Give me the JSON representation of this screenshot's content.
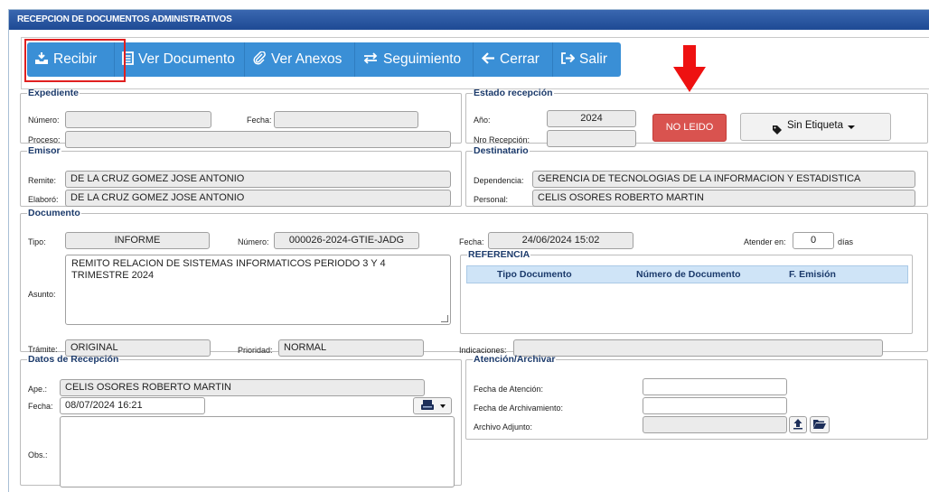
{
  "title": "RECEPCION DE DOCUMENTOS ADMINISTRATIVOS",
  "toolbar": {
    "recibir": "Recibir",
    "ver_documento": "Ver Documento",
    "ver_anexos": "Ver Anexos",
    "seguimiento": "Seguimiento",
    "cerrar": "Cerrar",
    "salir": "Salir"
  },
  "expediente": {
    "legend": "Expediente",
    "numero_label": "Número:",
    "numero": "",
    "fecha_label": "Fecha:",
    "fecha": "",
    "proceso_label": "Proceso:",
    "proceso": ""
  },
  "estado": {
    "legend": "Estado recepción",
    "anio_label": "Año:",
    "anio": "2024",
    "nro_label": "Nro Recepción:",
    "nro": "",
    "status": "NO LEIDO",
    "etiqueta": "Sin Etiqueta"
  },
  "emisor": {
    "legend": "Emisor",
    "remite_label": "Remite:",
    "remite": "DE LA CRUZ GOMEZ JOSE ANTONIO",
    "elaboro_label": "Elaboró:",
    "elaboro": "DE LA CRUZ GOMEZ JOSE ANTONIO"
  },
  "destinatario": {
    "legend": "Destinatario",
    "dependencia_label": "Dependencia:",
    "dependencia": "GERENCIA DE TECNOLOGIAS DE LA INFORMACION Y ESTADISTICA",
    "personal_label": "Personal:",
    "personal": "CELIS OSORES ROBERTO MARTIN"
  },
  "documento": {
    "legend": "Documento",
    "tipo_label": "Tipo:",
    "tipo": "INFORME",
    "numero_label": "Número:",
    "numero": "000026-2024-GTIE-JADG",
    "fecha_label": "Fecha:",
    "fecha": "24/06/2024 15:02",
    "atender_label": "Atender en:",
    "atender": "0",
    "dias_label": "días",
    "asunto_label": "Asunto:",
    "asunto": "REMITO RELACION DE SISTEMAS INFORMATICOS PERIODO 3 Y 4 TRIMESTRE 2024",
    "tramite_label": "Trámite:",
    "tramite": "ORIGINAL",
    "prioridad_label": "Prioridad:",
    "prioridad": "NORMAL",
    "indicaciones_label": "Indicaciones:",
    "indicaciones": ""
  },
  "referencia": {
    "legend": "REFERENCIA",
    "columns": [
      "Tipo Documento",
      "Número de Documento",
      "F. Emisión"
    ]
  },
  "recepcion": {
    "legend": "Datos de Recepción",
    "ape_label": "Ape.:",
    "ape": "CELIS OSORES ROBERTO MARTIN",
    "fecha_label": "Fecha:",
    "fecha": "08/07/2024 16:21",
    "obs_label": "Obs.:",
    "obs": ""
  },
  "atencion": {
    "legend": "Atención/Archivar",
    "fecha_atencion_label": "Fecha de Atención:",
    "fecha_atencion": "",
    "fecha_archivamiento_label": "Fecha de Archivamiento:",
    "fecha_archivamiento": "",
    "archivo_label": "Archivo Adjunto:",
    "archivo": ""
  },
  "colors": {
    "toolbar": "#3a8fd6",
    "titlebar": "#1e4a94",
    "status_red": "#d9534f",
    "highlight": "#e02020"
  },
  "icons": [
    "inbox-icon",
    "document-icon",
    "paperclip-icon",
    "swap-arrows-icon",
    "arrow-left-icon",
    "exit-icon",
    "tag-icon",
    "caret-down-icon",
    "scanner-icon",
    "upload-icon",
    "folder-open-icon",
    "red-arrow-down-icon"
  ]
}
